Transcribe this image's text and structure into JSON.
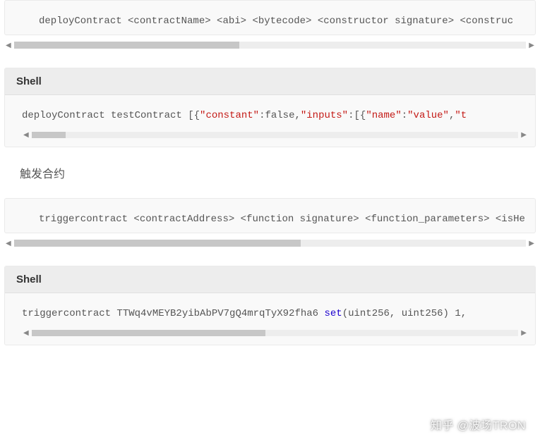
{
  "block1": {
    "code": "deployContract <contractName> <abi> <bytecode> <constructor signature>   <construc",
    "scroll_thumb_width": "44%"
  },
  "block2": {
    "header": "Shell",
    "code_prefix": "deployContract testContract [{",
    "s1": "\"constant\"",
    "p1": ":false,",
    "s2": "\"inputs\"",
    "p2": ":[{",
    "s3": "\"name\"",
    "p3": ":",
    "s4": "\"value\"",
    "p4": ",",
    "s5": "\"t",
    "scroll_thumb_width": "7%"
  },
  "section_title": "触发合约",
  "block3": {
    "code": "triggercontract <contractAddress> <function signature> <function_parameters> <isHe",
    "scroll_thumb_width": "56%"
  },
  "block4": {
    "header": "Shell",
    "code_prefix": "triggercontract TTWq4vMEYB2yibAbPV7gQ4mrqTyX92fha6 ",
    "kw1": "set",
    "code_suffix": "(uint256, uint256) 1,",
    "scroll_thumb_width": "48%"
  },
  "watermark": "知乎 @波场TRON"
}
